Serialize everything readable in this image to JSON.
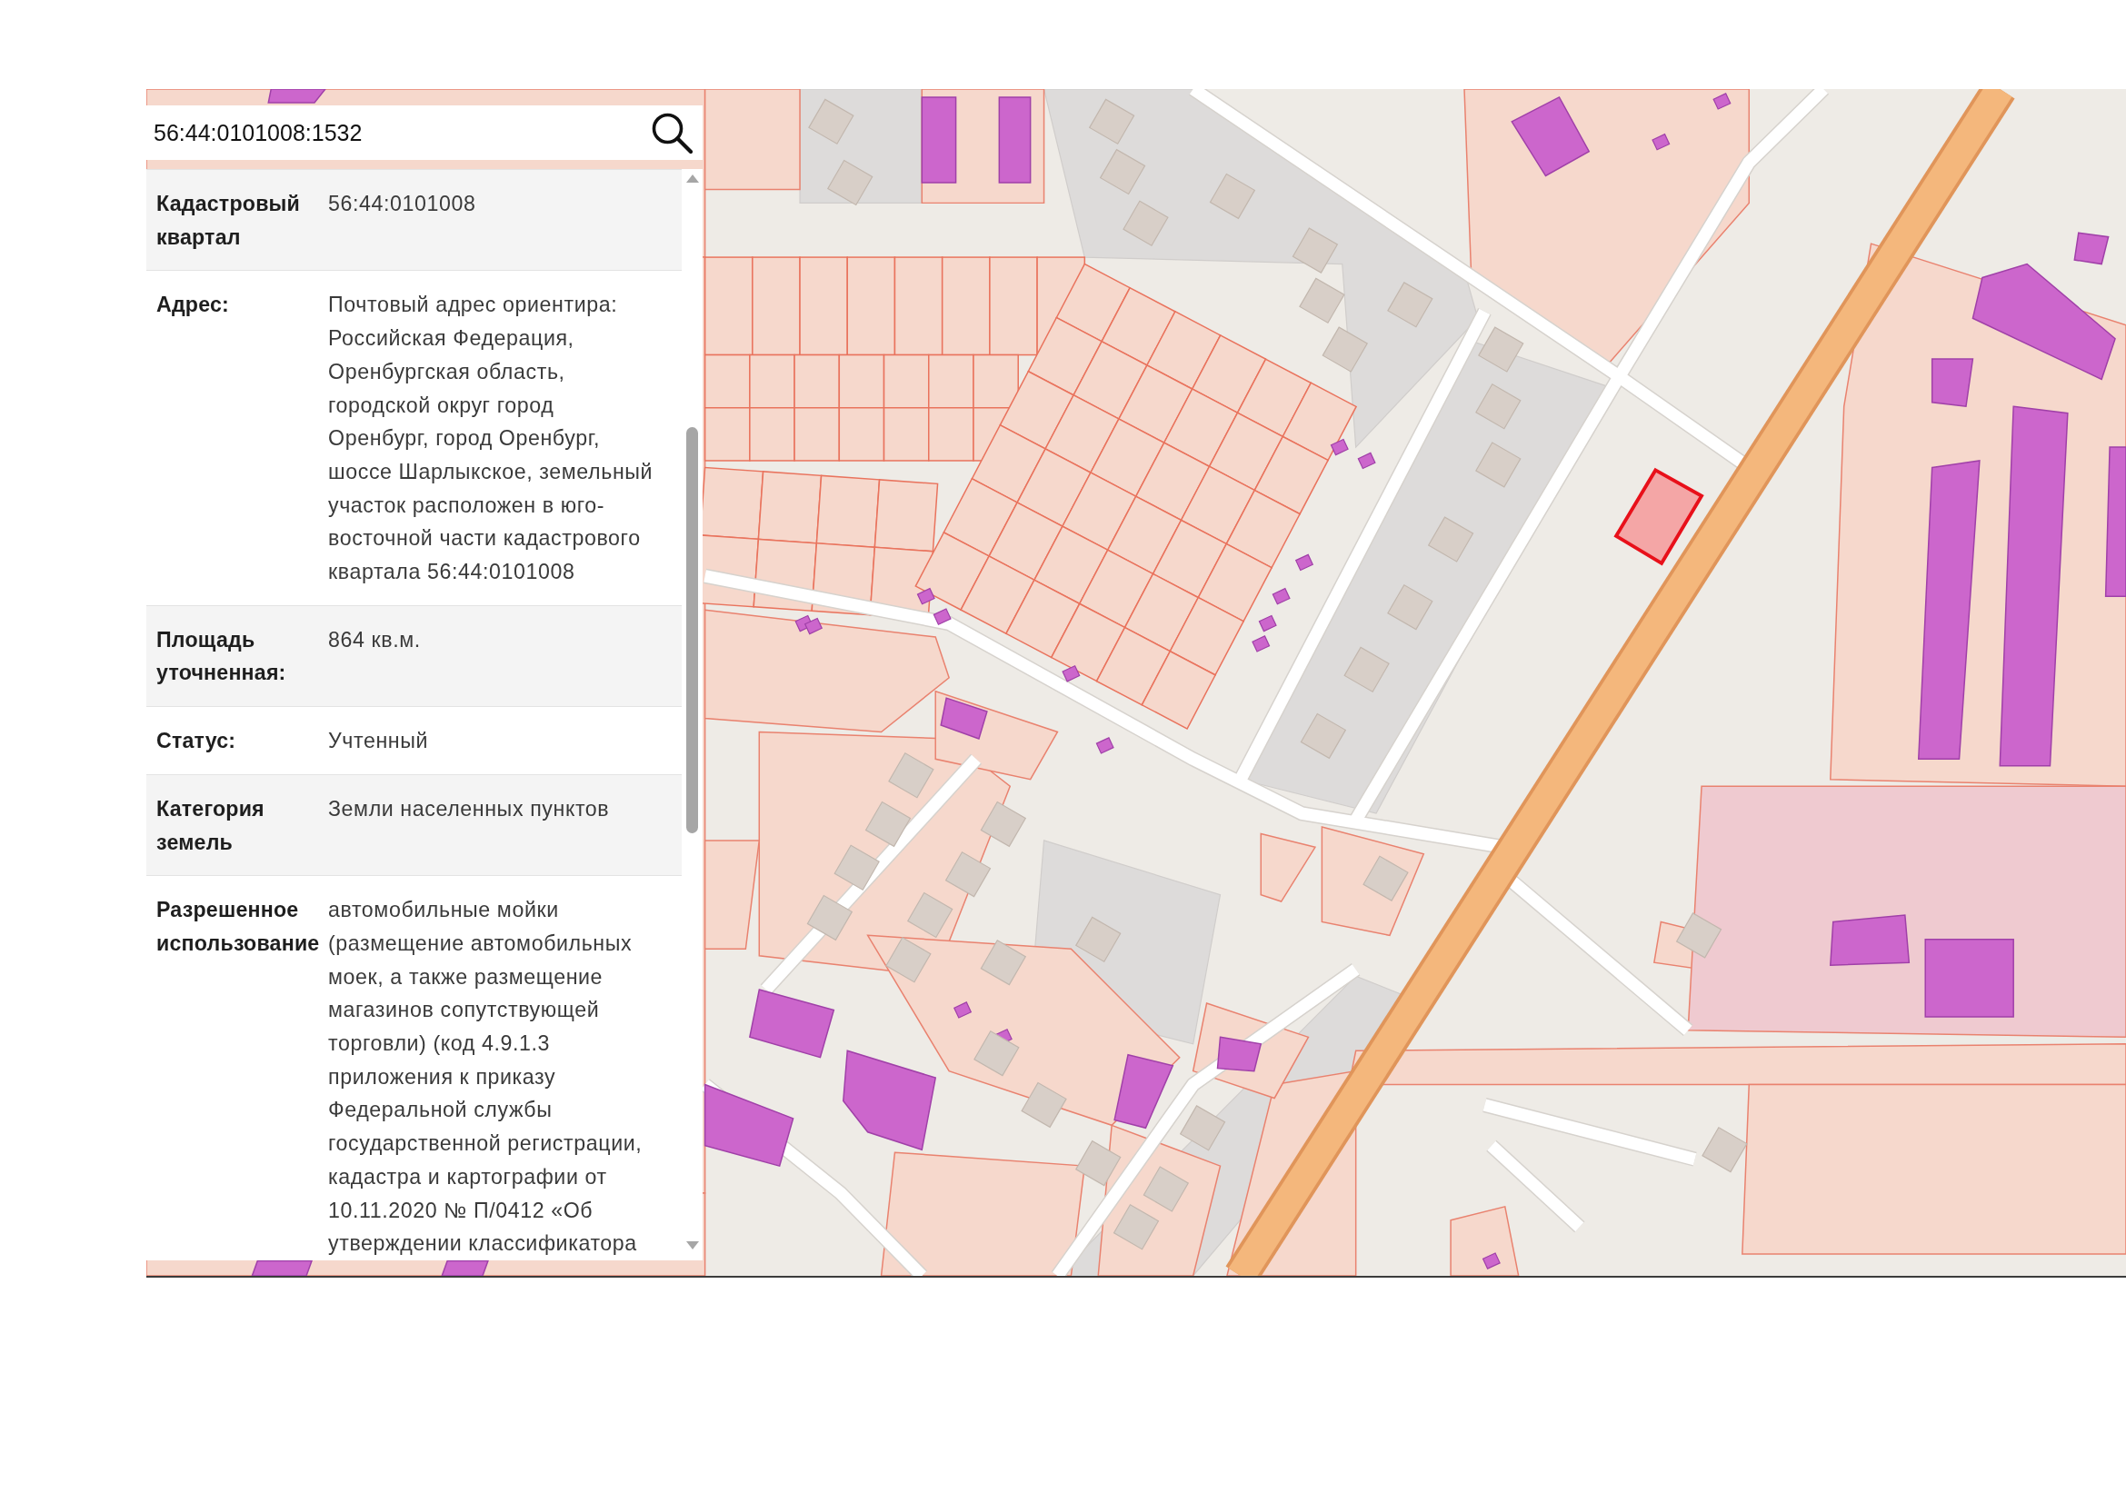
{
  "search": {
    "value": "56:44:0101008:1532"
  },
  "details": [
    {
      "label": "Кадастровый квартал",
      "value": "56:44:0101008"
    },
    {
      "label": "Адрес:",
      "value": "Почтовый адрес ориентира: Российская Федерация, Оренбургская область, городской округ город Оренбург, город Оренбург, шоссе Шарлыкское, земельный участок расположен в юго-восточной части кадастрового квартала 56:44:0101008"
    },
    {
      "label": "Площадь уточненная:",
      "value": "864 кв.м."
    },
    {
      "label": "Статус:",
      "value": "Учтенный"
    },
    {
      "label": "Категория земель",
      "value": "Земли населенных пунктов"
    },
    {
      "label": "Разрешенное использование",
      "value": "автомобильные мойки (размещение автомобильных моек, а также размещение магазинов сопутствующей торговли) (код 4.9.1.3 приложения к приказу Федеральной службы государственной регистрации, кадастра и картографии от 10.11.2020 № П/0412 «Об утверждении классификатора"
    }
  ]
}
